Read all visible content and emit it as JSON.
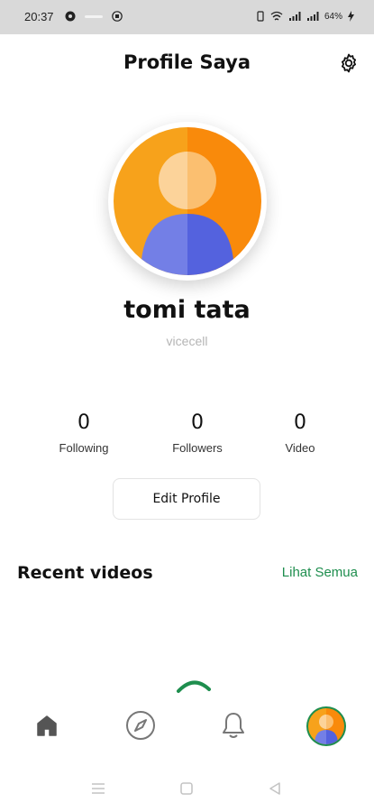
{
  "status_bar": {
    "time": "20:37",
    "battery": "64%"
  },
  "header": {
    "title": "Profile Saya",
    "settings_icon": "gear-icon"
  },
  "profile": {
    "name": "tomi tata",
    "username": "vicecell"
  },
  "stats": [
    {
      "value": "0",
      "label": "Following"
    },
    {
      "value": "0",
      "label": "Followers"
    },
    {
      "value": "0",
      "label": "Video"
    }
  ],
  "edit_profile_label": "Edit Profile",
  "recent": {
    "title": "Recent videos",
    "see_all": "Lihat Semua"
  },
  "bottom_nav": [
    {
      "icon": "home-icon",
      "active": false
    },
    {
      "icon": "compass-icon",
      "active": false
    },
    {
      "icon": "bell-icon",
      "active": false
    },
    {
      "icon": "avatar-icon",
      "active": true
    }
  ],
  "colors": {
    "accent_green": "#1e8e4e",
    "avatar_orange": "#f7a21b",
    "avatar_blue": "#6a78e4"
  }
}
